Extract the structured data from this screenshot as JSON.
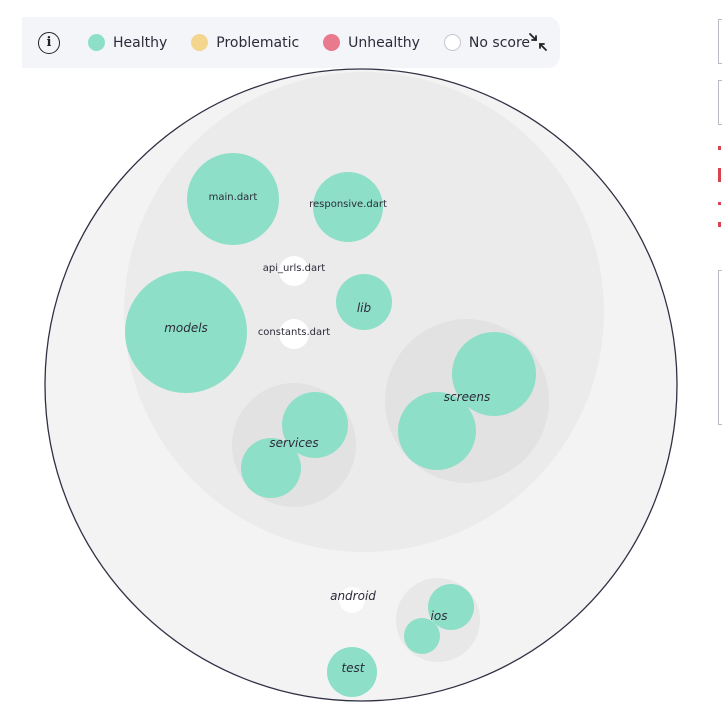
{
  "legend": {
    "info_icon": "info-icon",
    "items": [
      {
        "label": "Healthy",
        "color": "#8edfc7"
      },
      {
        "label": "Problematic",
        "color": "#f4d58d"
      },
      {
        "label": "Unhealthy",
        "color": "#e97a8e"
      },
      {
        "label": "No score",
        "color": "#ffffff"
      }
    ],
    "collapse_icon": "collapse-arrows-icon"
  },
  "colors": {
    "healthy": "#8edfc7",
    "no_score": "#ffffff",
    "root_fill": "#f3f3f3",
    "folder_fill": "#ebebeb",
    "subfolder_fill": "#e2e2e2",
    "outline": "#2f3042"
  },
  "tree": {
    "lib": {
      "label": "lib",
      "files": [
        {
          "label": "main.dart",
          "status": "healthy"
        },
        {
          "label": "responsive.dart",
          "status": "healthy"
        },
        {
          "label": "api_urls.dart",
          "status": "no_score"
        },
        {
          "label": "constants.dart",
          "status": "no_score"
        }
      ],
      "folders": {
        "models": {
          "label": "models",
          "status": "healthy"
        },
        "services": {
          "label": "services"
        },
        "screens": {
          "label": "screens"
        }
      }
    },
    "android": {
      "label": "android",
      "status": "no_score"
    },
    "ios": {
      "label": "ios"
    },
    "test": {
      "label": "test",
      "status": "healthy"
    }
  }
}
